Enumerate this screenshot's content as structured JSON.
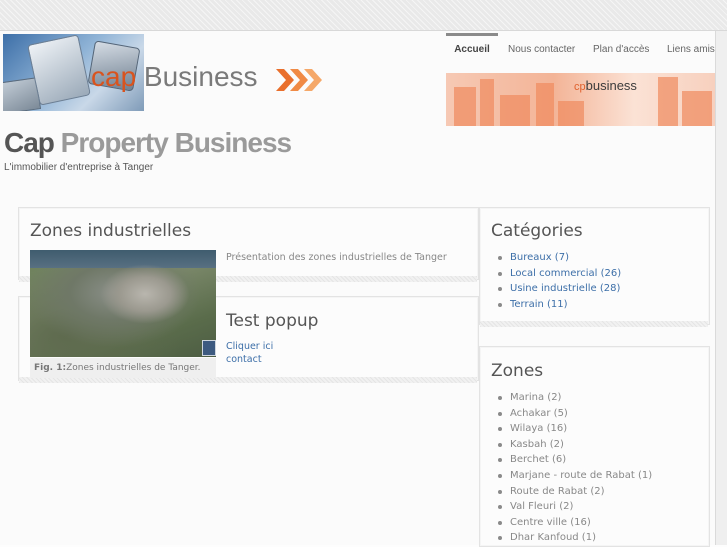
{
  "header": {
    "logo_text_cap": "cap",
    "logo_text_business": " Business",
    "logo_badge": "",
    "banner_small": "cp",
    "banner_big": "business",
    "site_title_1": "Cap",
    "site_title_2": " Property Business",
    "tagline": "L'immobilier d'entreprise à Tanger"
  },
  "nav": {
    "items": [
      {
        "label": "Accueil"
      },
      {
        "label": "Nous contacter"
      },
      {
        "label": "Plan d'accès"
      },
      {
        "label": "Liens amis"
      }
    ]
  },
  "main": {
    "post1": {
      "title": "Zones industrielles",
      "description": "Présentation des zones industrielles de Tanger",
      "caption_label": "Fig. 1:",
      "caption_text": "Zones industrielles de Tanger."
    },
    "post2": {
      "title": "Test popup",
      "link1": "Cliquer ici",
      "link2": "contact"
    }
  },
  "sidebar": {
    "categories_title": "Catégories",
    "categories": [
      {
        "label": "Bureaux (7)"
      },
      {
        "label": "Local commercial (26)"
      },
      {
        "label": "Usine industrielle (28)"
      },
      {
        "label": "Terrain (11)"
      }
    ],
    "zones_title": "Zones",
    "zones": [
      {
        "label": "Marina (2)"
      },
      {
        "label": "Achakar (5)"
      },
      {
        "label": "Wilaya (16)"
      },
      {
        "label": "Kasbah (2)"
      },
      {
        "label": "Berchet (6)"
      },
      {
        "label": "Marjane - route de Rabat (1)"
      },
      {
        "label": "Route de Rabat (2)"
      },
      {
        "label": "Val Fleuri (2)"
      },
      {
        "label": "Centre ville (16)"
      },
      {
        "label": "Dhar Kanfoud (1)"
      }
    ]
  },
  "colors": {
    "accent_orange": "#d9531e",
    "link_blue": "#3d6fa8"
  }
}
